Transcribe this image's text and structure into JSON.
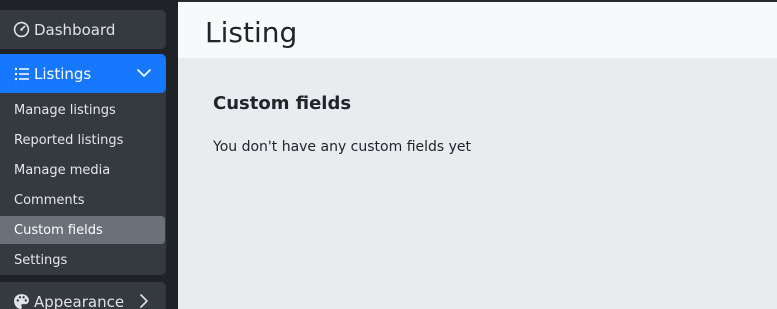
{
  "sidebar": {
    "dashboard": {
      "label": "Dashboard",
      "icon": "gauge-icon"
    },
    "listings": {
      "label": "Listings",
      "icon": "list-icon",
      "accent": "#1677ff",
      "items": [
        {
          "label": "Manage listings"
        },
        {
          "label": "Reported listings"
        },
        {
          "label": "Manage media"
        },
        {
          "label": "Comments"
        },
        {
          "label": "Custom fields",
          "active": true
        },
        {
          "label": "Settings"
        }
      ]
    },
    "appearance": {
      "label": "Appearance",
      "icon": "palette-icon"
    }
  },
  "header": {
    "title": "Listing"
  },
  "main": {
    "section_title": "Custom fields",
    "empty_message": "You don't have any custom fields yet"
  }
}
